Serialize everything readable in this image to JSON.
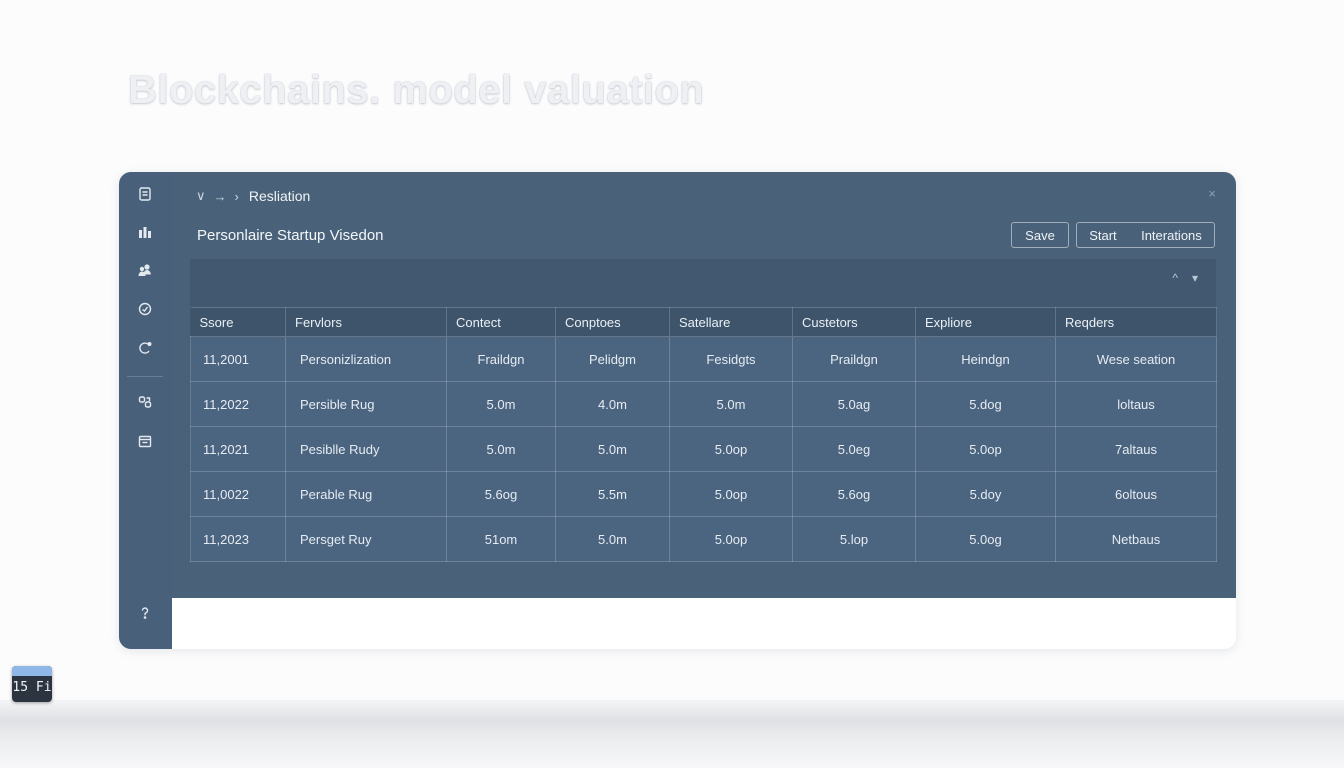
{
  "page": {
    "title": "Blockchains. model valuation"
  },
  "sidebar": {
    "icons": [
      "document-icon",
      "chart-icon",
      "users-icon",
      "target-icon",
      "refresh-icon",
      "link-icon",
      "calendar-icon",
      "help-icon"
    ]
  },
  "breadcrumb": {
    "label": "Resliation"
  },
  "window": {
    "close": "×"
  },
  "section": {
    "title": "Personlaire Startup Visedon"
  },
  "buttons": {
    "save": "Save",
    "start": "Start",
    "interactions": "Interations"
  },
  "panel": {
    "collapse": "^",
    "expand": "▾"
  },
  "table": {
    "headers": [
      "Ssore",
      "Fervlors",
      "Contect",
      "Conptoes",
      "Satellare",
      "Custetors",
      "Expliore",
      "Reqders"
    ],
    "rows": [
      [
        "11,2001",
        "Personizlization",
        "Fraildgn",
        "Pelidgm",
        "Fesidgts",
        "Praildgn",
        "Heindgn",
        "Wese seation"
      ],
      [
        "11,2022",
        "Persible Rug",
        "5.0m",
        "4.0m",
        "5.0m",
        "5.0ag",
        "5.dog",
        "loltaus"
      ],
      [
        "11,2021",
        "Pesiblle Rudy",
        "5.0m",
        "5.0m",
        "5.0op",
        "5.0eg",
        "5.0op",
        "7altaus"
      ],
      [
        "11,0022",
        "Perable Rug",
        "5.6og",
        "5.5m",
        "5.0op",
        "5.6og",
        "5.doy",
        "6oltous"
      ],
      [
        "11,2023",
        "Persget Ruy",
        "51om",
        "5.0m",
        "5.0op",
        "5.lop",
        "5.0og",
        "Netbaus"
      ]
    ]
  },
  "tray": {
    "text": "15 Fi"
  },
  "colors": {
    "sidebar": "#48607a",
    "main": "#4a6279",
    "panel": "#425870"
  }
}
